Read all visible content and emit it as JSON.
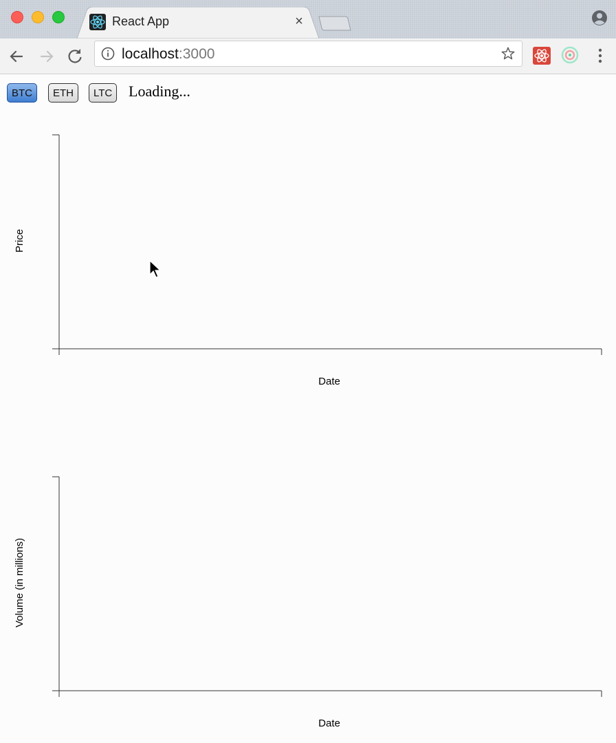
{
  "browser": {
    "tab_title": "React App",
    "tab_close": "×",
    "url_host": "localhost",
    "url_port": ":3000"
  },
  "coins": [
    "BTC",
    "ETH",
    "LTC"
  ],
  "active_coin": "BTC",
  "status_text": "Loading...",
  "chart_data": [
    {
      "type": "line",
      "xlabel": "Date",
      "ylabel": "Price",
      "series": []
    },
    {
      "type": "bar",
      "xlabel": "Date",
      "ylabel": "Volume (in millions)",
      "series": []
    }
  ],
  "colors": {
    "active_button": "#3e7ed2",
    "axis": "#333333"
  }
}
